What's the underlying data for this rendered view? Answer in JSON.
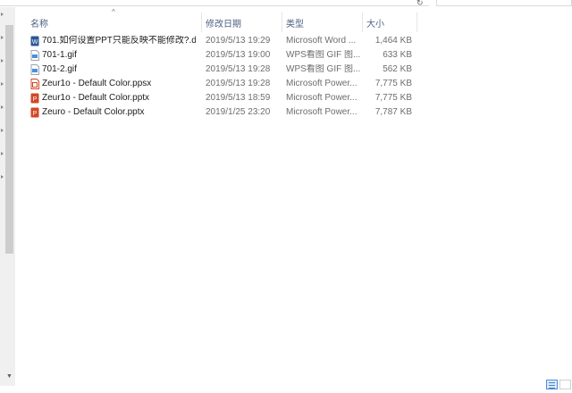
{
  "columns": {
    "name": "名称",
    "date": "修改日期",
    "type": "类型",
    "size": "大小"
  },
  "files": [
    {
      "name": "701.如何设置PPT只能反映不能修改?.d...",
      "date": "2019/5/13 19:29",
      "type": "Microsoft Word ...",
      "size": "1,464 KB",
      "icon": "word-doc-icon",
      "color": "#2b579a"
    },
    {
      "name": "701-1.gif",
      "date": "2019/5/13 19:00",
      "type": "WPS看图 GIF 图...",
      "size": "633 KB",
      "icon": "gif-image-icon",
      "color": "#4a90d9"
    },
    {
      "name": "701-2.gif",
      "date": "2019/5/13 19:28",
      "type": "WPS看图 GIF 图...",
      "size": "562 KB",
      "icon": "gif-image-icon",
      "color": "#4a90d9"
    },
    {
      "name": "Zeur1o - Default Color.ppsx",
      "date": "2019/5/13 19:28",
      "type": "Microsoft Power...",
      "size": "7,775 KB",
      "icon": "powerpoint-show-icon",
      "color": "#d24726"
    },
    {
      "name": "Zeur1o - Default Color.pptx",
      "date": "2019/5/13 18:59",
      "type": "Microsoft Power...",
      "size": "7,775 KB",
      "icon": "powerpoint-file-icon",
      "color": "#d24726"
    },
    {
      "name": "Zeuro - Default Color.pptx",
      "date": "2019/1/25 23:20",
      "type": "Microsoft Power...",
      "size": "7,787 KB",
      "icon": "powerpoint-file-icon",
      "color": "#d24726"
    }
  ],
  "colors": {
    "header_text": "#4d6082",
    "scroll_thumb": "#cdcdcd",
    "active_view": "#4a90d9"
  }
}
